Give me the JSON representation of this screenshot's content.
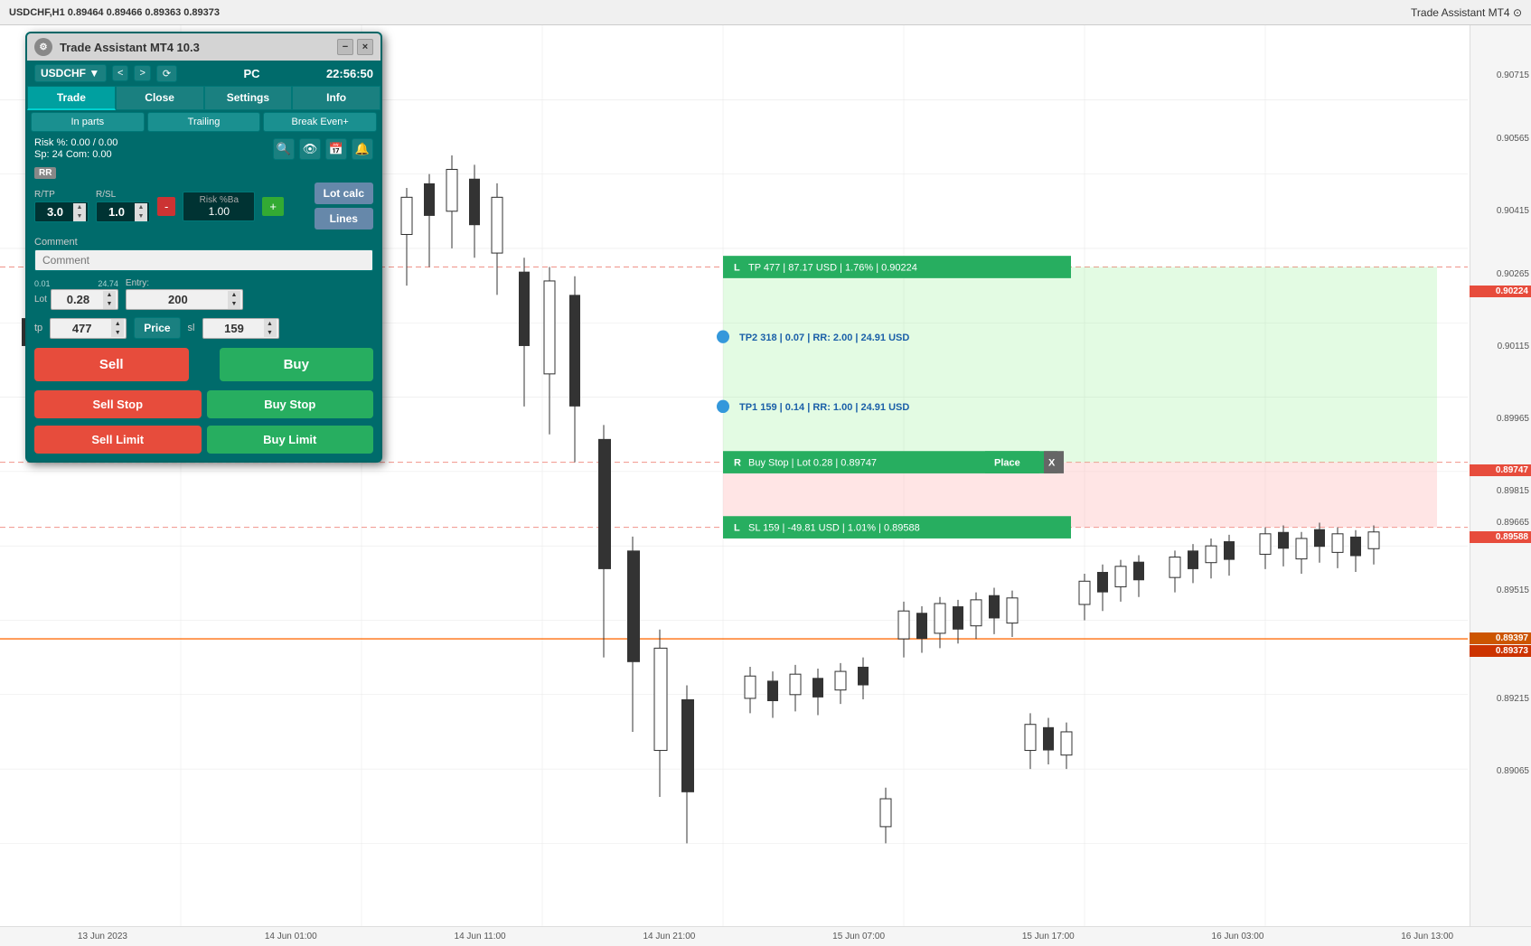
{
  "chart": {
    "topbar": {
      "symbol_info": "USDCHF,H1  0.89464 0.89466 0.89363 0.89373",
      "title_right": "Trade Assistant MT4 ⊙"
    },
    "prices": {
      "p1": "0.90715",
      "p2": "0.90565",
      "p3": "0.90415",
      "p4": "0.90265",
      "tp_red": "0.90224",
      "p5": "0.90115",
      "p6": "0.89965",
      "p7": "0.89815",
      "buystop_red": "0.89747",
      "p8": "0.89665",
      "sl_red": "0.89588",
      "p9": "0.89515",
      "current_orange": "0.89397",
      "current_val": "0.89373",
      "p10": "0.89215",
      "p11": "0.89065"
    },
    "annotations": {
      "tp_bar": "TP 477 | 87.17 USD | 1.76% | 0.90224",
      "tp2_label": "TP2 318 | 0.07 | RR: 2.00 | 24.91 USD",
      "tp1_label": "TP1 159 | 0.14 | RR: 1.00 | 24.91 USD",
      "buystop_bar": "Buy Stop | Lot 0.28 | 0.89747",
      "place_btn": "Place",
      "x_btn": "X",
      "sl_bar": "SL 159 | -49.81 USD | 1.01% | 0.89588",
      "l_badge": "L",
      "r_badge": "R"
    },
    "time_labels": [
      "13 Jun 2023",
      "14 Jun 01:00",
      "14 Jun 11:00",
      "14 Jun 21:00",
      "15 Jun 07:00",
      "15 Jun 17:00",
      "16 Jun 03:00",
      "16 Jun 13:00"
    ]
  },
  "widget": {
    "title": "Trade Assistant MT4 10.3",
    "minimize_btn": "−",
    "close_btn": "×",
    "symbol": "USDCHF",
    "nav_left": "<",
    "nav_right": ">",
    "chart_icon": "⟳",
    "pc_label": "PC",
    "time": "22:56:50",
    "tabs": {
      "trade": "Trade",
      "close": "Close",
      "settings": "Settings",
      "info": "Info"
    },
    "sub_tabs": {
      "in_parts": "In parts",
      "trailing": "Trailing",
      "break_even": "Break Even+"
    },
    "risk_row": {
      "text": "Risk %: 0.00 / 0.00",
      "sp_com": "Sp: 24  Com: 0.00"
    },
    "rr_section": {
      "rr_badge": "RR",
      "rtp_label": "R/TP",
      "rsl_label": "R/SL",
      "risk_ba_label": "Risk %Ba",
      "rtp_val": "3.0",
      "rsl_val": "1.0",
      "risk_ba_val": "1.00",
      "minus_btn": "-",
      "plus_btn": "+",
      "lot_calc_btn": "Lot calc",
      "lines_btn": "Lines"
    },
    "comment_section": {
      "label": "Comment",
      "placeholder": "Comment"
    },
    "lot_entry": {
      "lot_min": "0.01",
      "lot_max": "24.74",
      "lot_label": "Lot",
      "lot_val": "0.28",
      "entry_label": "Entry:",
      "entry_val": "200"
    },
    "tpsl": {
      "tp_label": "tp",
      "tp_val": "477",
      "price_btn": "Price",
      "sl_label": "sl",
      "sl_val": "159"
    },
    "buttons": {
      "sell": "Sell",
      "buy": "Buy",
      "sell_stop": "Sell Stop",
      "buy_stop": "Buy Stop",
      "sell_limit": "Sell Limit",
      "buy_limit": "Buy Limit"
    }
  }
}
